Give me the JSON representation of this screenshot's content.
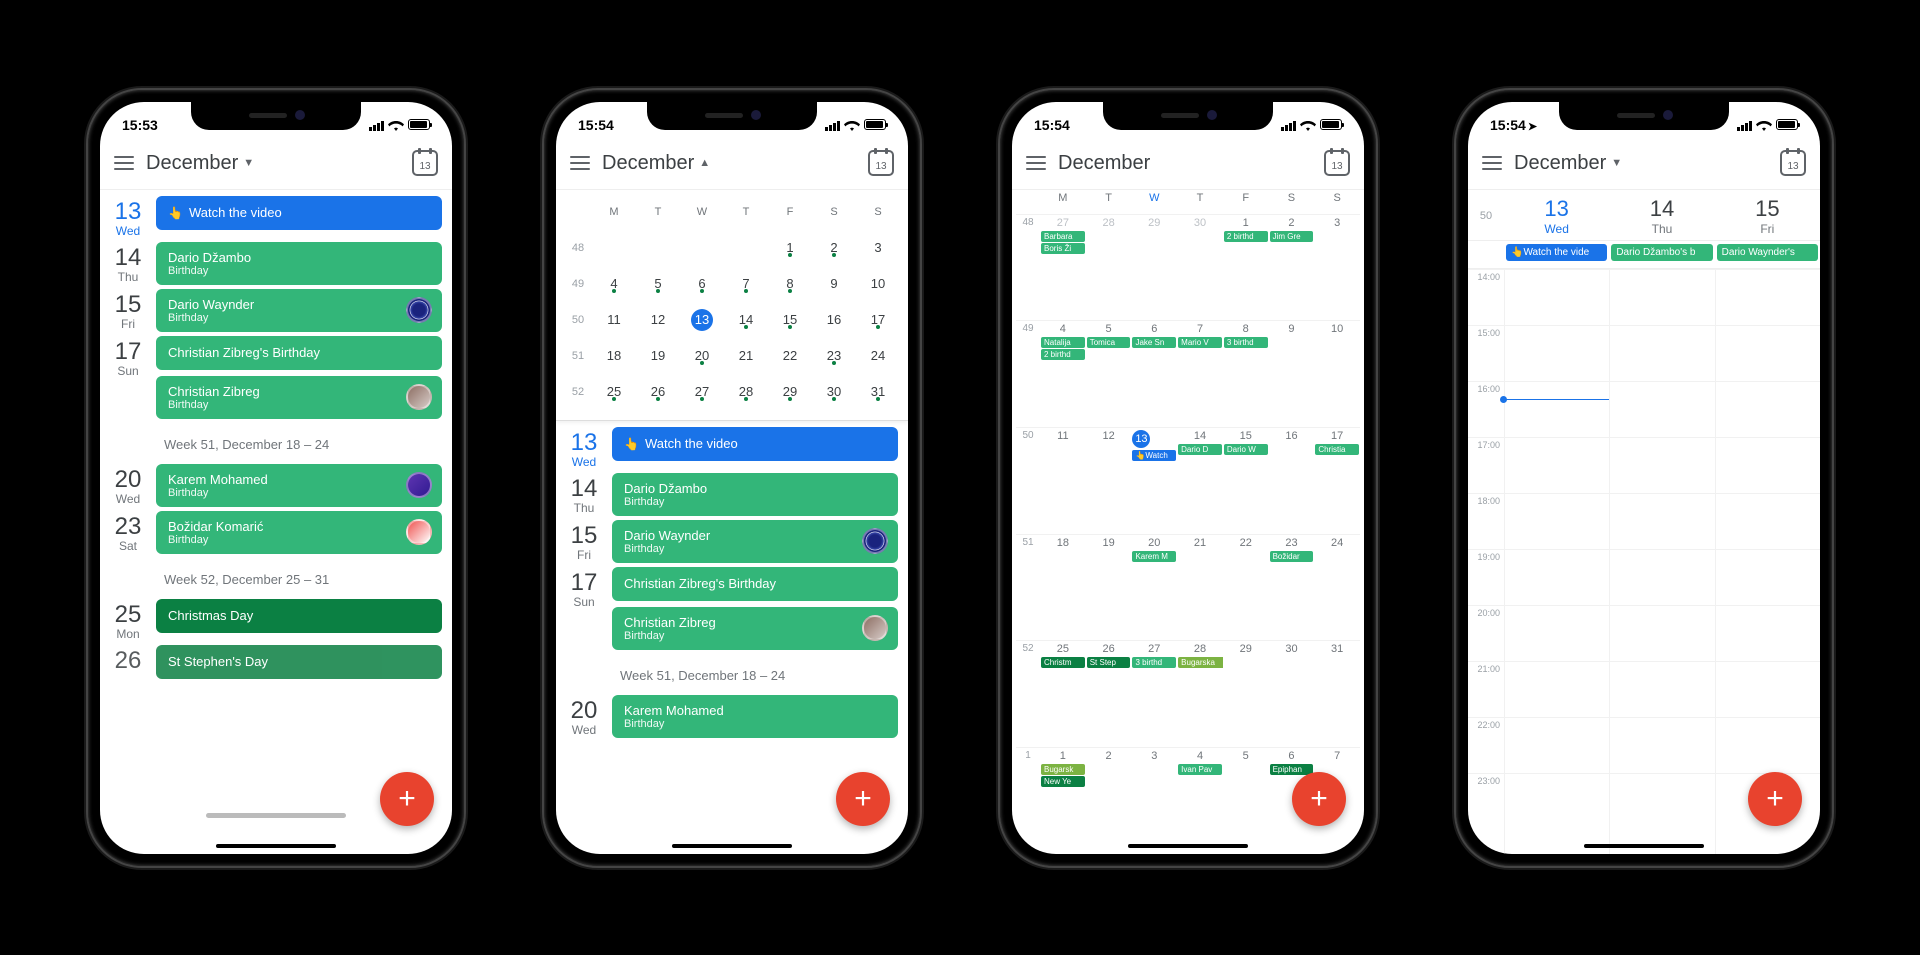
{
  "statusbar": {
    "time_a": "15:53",
    "time_b": "15:54",
    "loc_arrow": "➤"
  },
  "appbar": {
    "month": "December",
    "arr_down": "▼",
    "arr_up": "▲",
    "today_num": "13"
  },
  "agenda": {
    "d13": {
      "num": "13",
      "name": "Wed",
      "ev": [
        {
          "cls": "blue single",
          "title": "Watch the video",
          "icon": "👆"
        }
      ]
    },
    "d14": {
      "num": "14",
      "name": "Thu",
      "ev": [
        {
          "cls": "green",
          "title": "Dario Džambo",
          "sub": "Birthday"
        }
      ]
    },
    "d15": {
      "num": "15",
      "name": "Fri",
      "ev": [
        {
          "cls": "green",
          "title": "Dario Waynder",
          "sub": "Birthday",
          "av": "ring"
        }
      ]
    },
    "d17": {
      "num": "17",
      "name": "Sun",
      "ev": [
        {
          "cls": "green single",
          "title": "Christian Zibreg's Birthday"
        },
        {
          "cls": "green",
          "title": "Christian Zibreg",
          "sub": "Birthday",
          "av": "photo1"
        }
      ]
    },
    "wk51": "Week 51, December 18 – 24",
    "d20": {
      "num": "20",
      "name": "Wed",
      "ev": [
        {
          "cls": "green",
          "title": "Karem Mohamed",
          "sub": "Birthday",
          "av": "photo2"
        }
      ]
    },
    "d23": {
      "num": "23",
      "name": "Sat",
      "ev": [
        {
          "cls": "green",
          "title": "Božidar Komarić",
          "sub": "Birthday",
          "av": "photo3"
        }
      ]
    },
    "wk52": "Week 52, December 25 – 31",
    "d25": {
      "num": "25",
      "name": "Mon",
      "ev": [
        {
          "cls": "dgreen single",
          "title": "Christmas Day"
        }
      ]
    },
    "d26": {
      "num": "26",
      "name": "",
      "ev": [
        {
          "cls": "dgreen single",
          "title": "St Stephen's Day"
        }
      ]
    }
  },
  "mini": {
    "hdr": [
      "M",
      "T",
      "W",
      "T",
      "F",
      "S",
      "S"
    ],
    "weeks": [
      {
        "w": "48",
        "d": [
          " ",
          " ",
          " ",
          " ",
          "1",
          "2",
          "3"
        ],
        "dots": [
          0,
          0,
          0,
          0,
          1,
          1,
          0
        ]
      },
      {
        "w": "49",
        "d": [
          "4",
          "5",
          "6",
          "7",
          "8",
          "9",
          "10"
        ],
        "dots": [
          1,
          1,
          1,
          1,
          1,
          0,
          0
        ]
      },
      {
        "w": "50",
        "d": [
          "11",
          "12",
          "13",
          "14",
          "15",
          "16",
          "17"
        ],
        "dots": [
          0,
          0,
          0,
          1,
          1,
          0,
          1
        ],
        "today": 2
      },
      {
        "w": "51",
        "d": [
          "18",
          "19",
          "20",
          "21",
          "22",
          "23",
          "24"
        ],
        "dots": [
          0,
          0,
          1,
          0,
          0,
          1,
          0
        ]
      },
      {
        "w": "52",
        "d": [
          "25",
          "26",
          "27",
          "28",
          "29",
          "30",
          "31"
        ],
        "dots": [
          1,
          1,
          1,
          1,
          1,
          1,
          1
        ]
      }
    ]
  },
  "month": {
    "hdr": [
      "M",
      "T",
      "W",
      "T",
      "F",
      "S",
      "S"
    ],
    "weeks": [
      {
        "w": "48",
        "days": [
          {
            "n": "27",
            "o": 1
          },
          {
            "n": "28",
            "o": 1
          },
          {
            "n": "29",
            "o": 1
          },
          {
            "n": "30",
            "o": 1
          },
          {
            "n": "1",
            "ev": [
              {
                "c": "g",
                "t": "2 birthd"
              }
            ]
          },
          {
            "n": "2",
            "ev": [
              {
                "c": "g",
                "t": "Jim Gre"
              }
            ]
          },
          {
            "n": "3"
          }
        ],
        "extra": [
          {
            "col": 0,
            "c": "g",
            "t": "Barbara"
          },
          {
            "col": 0,
            "c": "g",
            "t": "Boris Ži"
          }
        ]
      },
      {
        "w": "49",
        "days": [
          {
            "n": "4",
            "ev": [
              {
                "c": "g",
                "t": "Natalija"
              },
              {
                "c": "g",
                "t": "2 birthd"
              }
            ]
          },
          {
            "n": "5",
            "ev": [
              {
                "c": "g",
                "t": "Tomica"
              }
            ]
          },
          {
            "n": "6",
            "ev": [
              {
                "c": "g",
                "t": "Jake Sn"
              }
            ]
          },
          {
            "n": "7",
            "ev": [
              {
                "c": "g",
                "t": "Mario V"
              }
            ]
          },
          {
            "n": "8",
            "ev": [
              {
                "c": "g",
                "t": "3 birthd"
              }
            ]
          },
          {
            "n": "9"
          },
          {
            "n": "10"
          }
        ]
      },
      {
        "w": "50",
        "days": [
          {
            "n": "11"
          },
          {
            "n": "12"
          },
          {
            "n": "13",
            "today": 1,
            "ev": [
              {
                "c": "bl",
                "t": "👆Watch"
              }
            ]
          },
          {
            "n": "14",
            "ev": [
              {
                "c": "g",
                "t": "Dario D"
              }
            ]
          },
          {
            "n": "15",
            "ev": [
              {
                "c": "g",
                "t": "Dario W"
              }
            ]
          },
          {
            "n": "16"
          },
          {
            "n": "17",
            "ev": [
              {
                "c": "g",
                "t": "Christia"
              }
            ]
          }
        ]
      },
      {
        "w": "51",
        "days": [
          {
            "n": "18"
          },
          {
            "n": "19"
          },
          {
            "n": "20",
            "ev": [
              {
                "c": "g",
                "t": "Karem M"
              }
            ]
          },
          {
            "n": "21"
          },
          {
            "n": "22"
          },
          {
            "n": "23",
            "ev": [
              {
                "c": "g",
                "t": "Božidar"
              }
            ]
          },
          {
            "n": "24"
          }
        ]
      },
      {
        "w": "52",
        "days": [
          {
            "n": "25",
            "ev": [
              {
                "c": "dg",
                "t": "Christm"
              }
            ]
          },
          {
            "n": "26",
            "ev": [
              {
                "c": "dg",
                "t": "St Step"
              }
            ]
          },
          {
            "n": "27",
            "ev": [
              {
                "c": "g",
                "t": "3 birthd"
              }
            ]
          },
          {
            "n": "28",
            "span": {
              "c": "lg",
              "t": "Bugarska",
              "cols": 4
            }
          },
          {
            "n": "29"
          },
          {
            "n": "30"
          },
          {
            "n": "31"
          }
        ]
      },
      {
        "w": "1",
        "days": [
          {
            "n": "1",
            "ev": [
              {
                "c": "lg",
                "t": "Bugarsk"
              },
              {
                "c": "dg",
                "t": "New Ye"
              }
            ]
          },
          {
            "n": "2"
          },
          {
            "n": "3"
          },
          {
            "n": "4",
            "ev": [
              {
                "c": "g",
                "t": "Ivan Pav"
              }
            ]
          },
          {
            "n": "5"
          },
          {
            "n": "6",
            "ev": [
              {
                "c": "dg",
                "t": "Epiphan"
              }
            ]
          },
          {
            "n": "7"
          }
        ]
      }
    ]
  },
  "threeday": {
    "wk": "50",
    "cols": [
      {
        "num": "13",
        "name": "Wed",
        "today": true,
        "allday": {
          "c": "bl",
          "t": "👆Watch the vide"
        }
      },
      {
        "num": "14",
        "name": "Thu",
        "allday": {
          "c": "g",
          "t": "Dario Džambo's b"
        }
      },
      {
        "num": "15",
        "name": "Fri",
        "allday": {
          "c": "g",
          "t": "Dario Waynder's"
        }
      }
    ],
    "hours": [
      "14:00",
      "15:00",
      "16:00",
      "17:00",
      "18:00",
      "19:00",
      "20:00",
      "21:00",
      "22:00",
      "23:00"
    ]
  },
  "fab": "+"
}
